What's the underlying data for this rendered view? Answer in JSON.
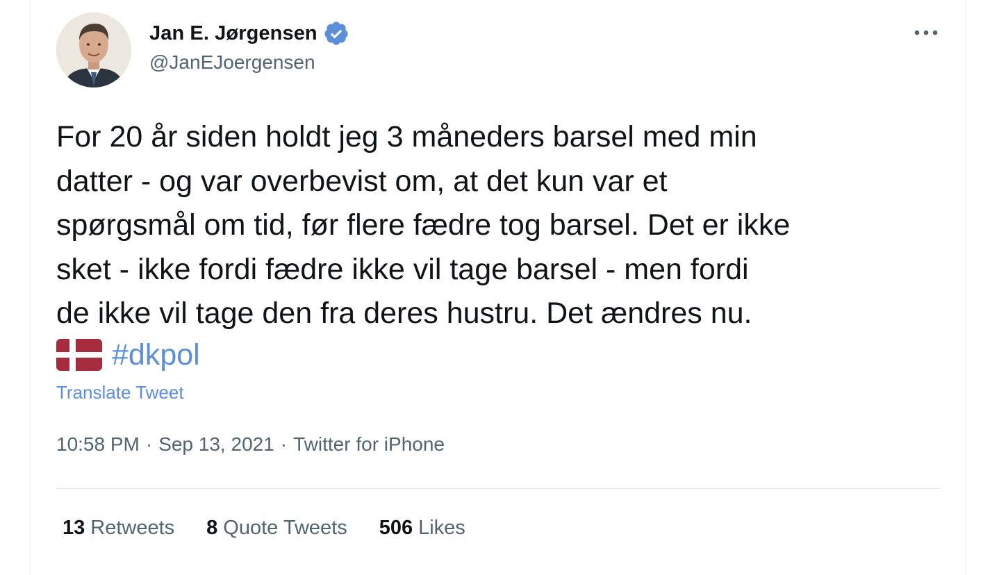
{
  "author": {
    "display_name": "Jan E. Jørgensen",
    "handle": "@JanEJoergensen",
    "verified": true,
    "avatar_icon": "profile-photo"
  },
  "menu": {
    "icon": "more-horizontal-icon"
  },
  "tweet": {
    "lines": [
      "For 20 år siden holdt jeg 3 måneders barsel med min",
      "datter - og var overbevist om, at det kun var et",
      "spørgsmål om tid, før flere fædre tog barsel. Det er ikke",
      "sket - ikke fordi fædre ikke vil tage barsel - men fordi",
      "de ikke vil tage den fra deres hustru. Det ændres nu."
    ],
    "flag_icon": "denmark-flag-icon",
    "hashtag": "#dkpol",
    "translate_label": "Translate Tweet"
  },
  "meta": {
    "time": "10:58 PM",
    "separator": "·",
    "date": "Sep 13, 2021",
    "source": "Twitter for iPhone"
  },
  "stats": {
    "retweets_count": "13",
    "retweets_label": "Retweets",
    "quotes_count": "8",
    "quotes_label": "Quote Tweets",
    "likes_count": "506",
    "likes_label": "Likes"
  },
  "colors": {
    "link": "#5b8fd8",
    "verified_badge": "#5b8fd8",
    "secondary_text": "#536471",
    "primary_text": "#0f1419",
    "flag_red": "#a62b3c"
  }
}
